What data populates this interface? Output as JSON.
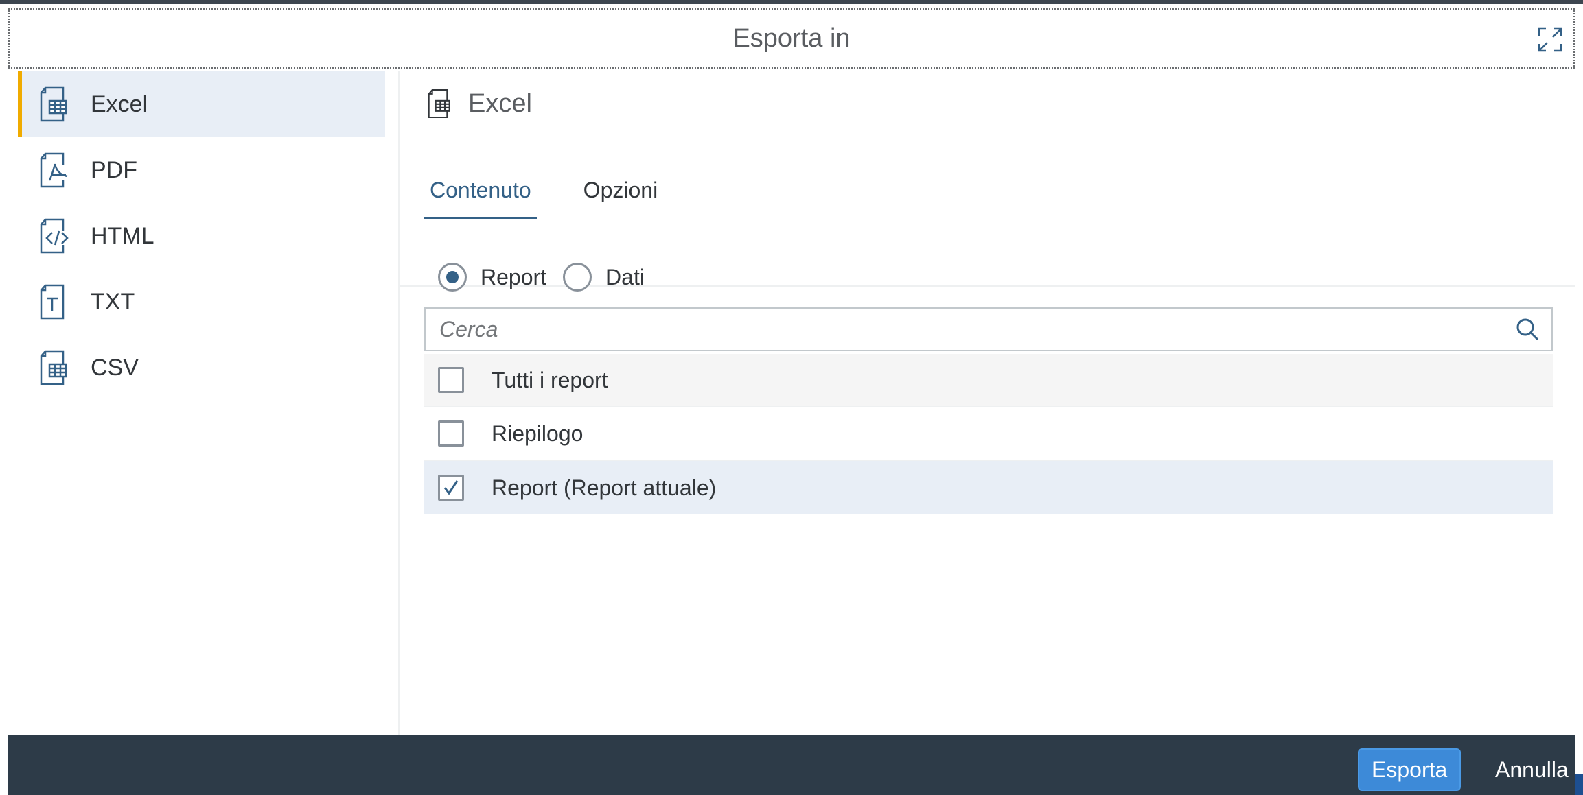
{
  "dialog": {
    "title": "Esporta in"
  },
  "sidebar": {
    "items": [
      {
        "label": "Excel",
        "icon": "excel-file-icon",
        "selected": true
      },
      {
        "label": "PDF",
        "icon": "pdf-file-icon",
        "selected": false
      },
      {
        "label": "HTML",
        "icon": "html-file-icon",
        "selected": false
      },
      {
        "label": "TXT",
        "icon": "txt-file-icon",
        "selected": false
      },
      {
        "label": "CSV",
        "icon": "csv-file-icon",
        "selected": false
      }
    ]
  },
  "main": {
    "title": "Excel",
    "tabs": [
      {
        "label": "Contenuto",
        "active": true
      },
      {
        "label": "Opzioni",
        "active": false
      }
    ],
    "radios": [
      {
        "label": "Report",
        "checked": true
      },
      {
        "label": "Dati",
        "checked": false
      }
    ],
    "search": {
      "placeholder": "Cerca",
      "value": ""
    },
    "list": [
      {
        "label": "Tutti i report",
        "checked": false
      },
      {
        "label": "Riepilogo",
        "checked": false
      },
      {
        "label": "Report (Report attuale)",
        "checked": true
      }
    ]
  },
  "footer": {
    "export_label": "Esporta",
    "cancel_label": "Annulla"
  },
  "colors": {
    "accent": "#346187",
    "selected_bg": "#e8eef6",
    "indicator": "#f0ab00",
    "footer_bg": "#2d3b48",
    "primary_button": "#3d8ad8"
  }
}
